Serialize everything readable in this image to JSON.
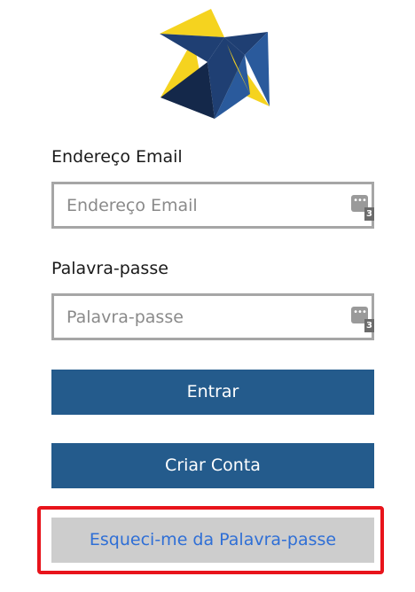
{
  "brand": {
    "logo_icon": "star-logo-icon",
    "colors": {
      "navy": "#1f3f73",
      "dark": "#14284a",
      "yellow": "#f5d31f"
    }
  },
  "login_form": {
    "email_label": "Endereço Email",
    "email_placeholder": "Endereço Email",
    "password_label": "Palavra-passe",
    "password_placeholder": "Palavra-passe",
    "password_manager_icon": "password-manager-icon",
    "password_manager_badge_dots": "•••",
    "password_manager_count": "3",
    "login_button": "Entrar",
    "create_account_button": "Criar Conta",
    "forgot_password_button": "Esqueci-me da Palavra-passe"
  },
  "colors": {
    "primary_button": "#245b8c",
    "secondary_button_bg": "#cdcdcd",
    "link_text": "#2f6fd6",
    "highlight_border": "#e8141b"
  }
}
